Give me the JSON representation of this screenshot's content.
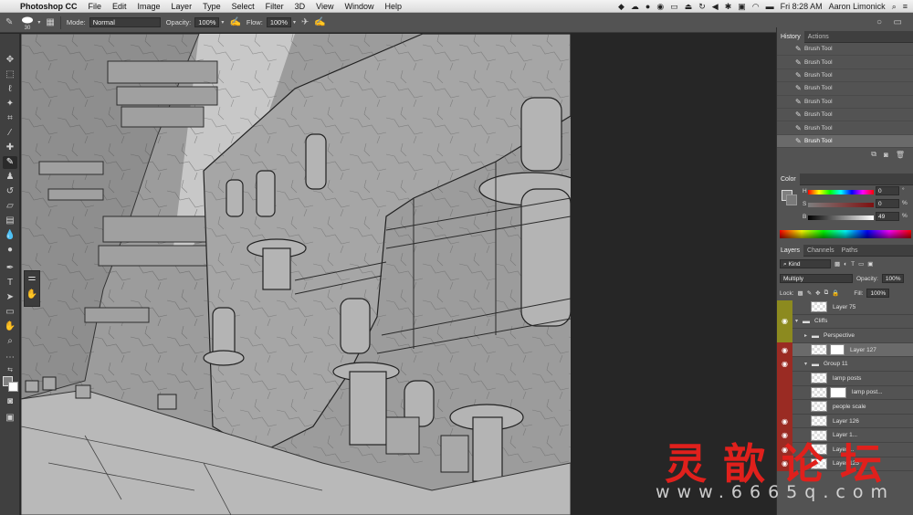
{
  "menubar": {
    "app_name": "Photoshop CC",
    "items": [
      "File",
      "Edit",
      "Image",
      "Layer",
      "Type",
      "Select",
      "Filter",
      "3D",
      "View",
      "Window",
      "Help"
    ],
    "clock": "Fri 8:28 AM",
    "user": "Aaron Limonick"
  },
  "options": {
    "brush_size": "30",
    "mode_label": "Mode:",
    "mode_value": "Normal",
    "opacity_label": "Opacity:",
    "opacity_value": "100%",
    "flow_label": "Flow:",
    "flow_value": "100%"
  },
  "history": {
    "tabs": [
      "History",
      "Actions"
    ],
    "items": [
      "Brush Tool",
      "Brush Tool",
      "Brush Tool",
      "Brush Tool",
      "Brush Tool",
      "Brush Tool",
      "Brush Tool",
      "Brush Tool"
    ]
  },
  "color": {
    "tab": "Color",
    "h_label": "H",
    "h_value": "0",
    "h_unit": "°",
    "s_label": "S",
    "s_value": "0",
    "s_unit": "%",
    "b_label": "B",
    "b_value": "49",
    "b_unit": "%"
  },
  "layers": {
    "tabs": [
      "Layers",
      "Channels",
      "Paths"
    ],
    "kind_label": "Kind",
    "blend_mode": "Multiply",
    "opacity_label": "Opacity:",
    "opacity_value": "100%",
    "lock_label": "Lock:",
    "fill_label": "Fill:",
    "fill_value": "100%",
    "rows": [
      {
        "name": "Layer 75",
        "vis": "yellow"
      },
      {
        "name": "Cliffs",
        "vis": "yellow"
      },
      {
        "name": "Perspective",
        "vis": "yellow"
      },
      {
        "name": "Layer 127",
        "vis": "red"
      },
      {
        "name": "Group 11",
        "vis": "red"
      },
      {
        "name": "lamp posts",
        "vis": "red"
      },
      {
        "name": "lamp post...",
        "vis": "red"
      },
      {
        "name": "people scale",
        "vis": "red"
      },
      {
        "name": "Layer 126",
        "vis": "red"
      },
      {
        "name": "Layer 1...",
        "vis": "red"
      },
      {
        "name": "Layer ...",
        "vis": "red"
      },
      {
        "name": "Layer 125",
        "vis": "red"
      }
    ]
  },
  "watermark": {
    "chinese": "灵歆论坛",
    "url": "www.6665q.com"
  },
  "colors": {
    "menubar": "#e8e8e8",
    "panel": "#535353",
    "canvas_bg": "#a8a8a8",
    "eye_yellow": "#8c8a1f",
    "eye_red": "#9a2b23",
    "watermark_red": "#e0201c"
  }
}
